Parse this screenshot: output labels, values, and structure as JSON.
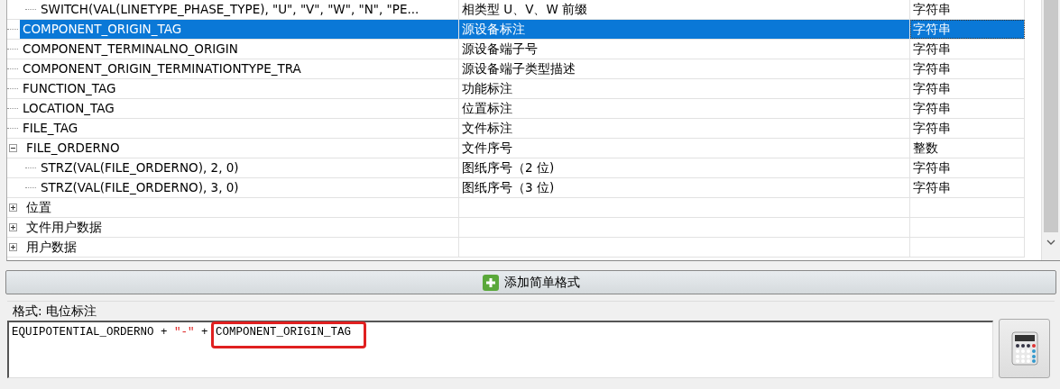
{
  "tree": {
    "continued_children": [
      {
        "column_1": "SWITCH(VAL(LINETYPE_PHASE_TYPE), \"U\", \"V\", \"W\", \"N\", \"PE...",
        "column_2": "相类型 U、V、W 前缀",
        "column_3": "字符串",
        "selected": false
      }
    ],
    "items": [
      {
        "column_1": "COMPONENT_ORIGIN_TAG",
        "column_2": "源设备标注",
        "column_3": "字符串",
        "selected": true
      },
      {
        "column_1": "COMPONENT_TERMINALNO_ORIGIN",
        "column_2": "源设备端子号",
        "column_3": "字符串",
        "selected": false
      },
      {
        "column_1": "COMPONENT_ORIGIN_TERMINATIONTYPE_TRA",
        "column_2": "源设备端子类型描述",
        "column_3": "字符串",
        "selected": false
      },
      {
        "column_1": "FUNCTION_TAG",
        "column_2": "功能标注",
        "column_3": "字符串",
        "selected": false
      },
      {
        "column_1": "LOCATION_TAG",
        "column_2": "位置标注",
        "column_3": "字符串",
        "selected": false
      },
      {
        "column_1": "FILE_TAG",
        "column_2": "文件标注",
        "column_3": "字符串",
        "selected": false
      },
      {
        "column_1": "FILE_ORDERNO",
        "column_2": "文件序号",
        "column_3": "整数",
        "selected": false,
        "expanded": true,
        "children": [
          {
            "column_1": "STRZ(VAL(FILE_ORDERNO), 2, 0)",
            "column_2": "图纸序号（2 位)",
            "column_3": "字符串",
            "selected": false
          },
          {
            "column_1": "STRZ(VAL(FILE_ORDERNO), 3, 0)",
            "column_2": "图纸序号（3 位)",
            "column_3": "字符串",
            "selected": false
          }
        ]
      },
      {
        "column_1": "位置",
        "selected": false,
        "expanded": false
      },
      {
        "column_1": "文件用户数据",
        "selected": false,
        "expanded": false
      },
      {
        "column_1": "用户数据",
        "selected": false,
        "expanded": false
      }
    ]
  },
  "add_button": {
    "label": "添加简单格式"
  },
  "format": {
    "label": "格式: 电位标注",
    "parts": [
      {
        "text": "EQUIPOTENTIAL_ORDERNO + ",
        "kind": "field"
      },
      {
        "text": "\"-\"",
        "kind": "string"
      },
      {
        "text": " + ",
        "kind": "field"
      },
      {
        "text": "COMPONENT_ORIGIN_TAG",
        "kind": "field",
        "highlighted": true
      }
    ]
  }
}
